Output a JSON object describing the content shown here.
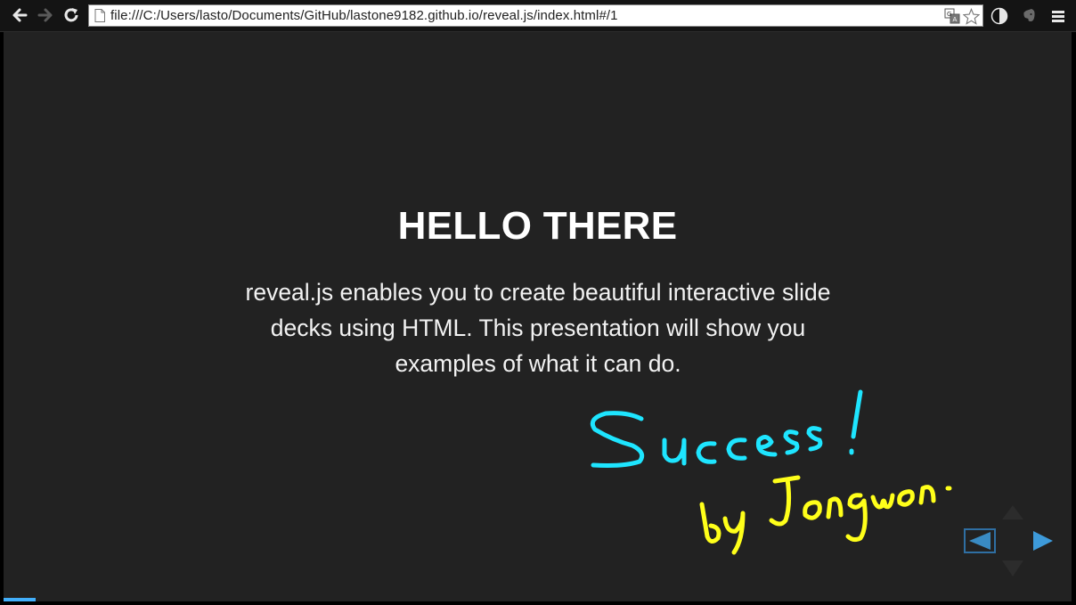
{
  "browser": {
    "url": "file:///C:/Users/lasto/Documents/GitHub/lastone9182.github.io/reveal.js/index.html#/1",
    "icons": [
      "back-arrow-icon",
      "forward-arrow-icon",
      "reload-icon",
      "page-icon",
      "translate-icon",
      "star-icon",
      "contrast-extension-icon",
      "evernote-extension-icon",
      "menu-icon"
    ]
  },
  "slide": {
    "title": "HELLO THERE",
    "line1": "reveal.js enables you to create beautiful interactive slide",
    "line2": "decks using HTML. This presentation will show you",
    "line3": "examples of what it can do.",
    "handwriting_success": "Success!",
    "handwriting_author": "by Jongwon."
  },
  "progress": {
    "value": 0.03,
    "color": "#42affa"
  },
  "colors": {
    "background": "#222222",
    "text": "#ffffff",
    "handwriting_success": "#1ee5ff",
    "handwriting_author": "#ffff1a",
    "controls": "#42affa"
  }
}
